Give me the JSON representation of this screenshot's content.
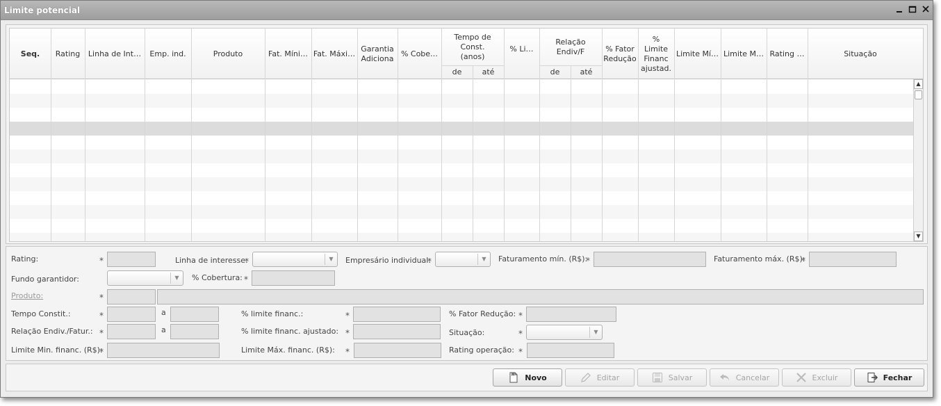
{
  "window": {
    "title": "Limite potencial"
  },
  "grid": {
    "headers": {
      "seq": "Seq.",
      "rating": "Rating",
      "linha": "Linha de Int…",
      "emp": "Emp. ind.",
      "produto": "Produto",
      "fat_min": "Fat. Míni…",
      "fat_max": "Fat. Máxi…",
      "garantia_1": "Garantia",
      "garantia_2": "Adiciona",
      "cobertura": "% Cobe…",
      "tempo_1": "Tempo de",
      "tempo_2": "Const.",
      "tempo_3": "(anos)",
      "tempo_de": "de",
      "tempo_ate": "até",
      "limite": "% Li…",
      "relacao_1": "Relação",
      "relacao_2": "Endiv/F",
      "relacao_de": "de",
      "relacao_ate": "até",
      "fator_1": "% Fator",
      "fator_2": "Redução",
      "lim_aj_1": "%",
      "lim_aj_2": "Limite",
      "lim_aj_3": "Financ",
      "lim_aj_4": "ajustad.",
      "limite_min": "Limite Mí…",
      "limite_max": "Limite M…",
      "rating_op": "Rating …",
      "situacao": "Situação"
    },
    "rows": 12,
    "selected_row": 3
  },
  "form": {
    "rating": "Rating:",
    "linha_interesse": "Linha de interesse:",
    "empresario": "Empresário individual:",
    "fat_min": "Faturamento mín. (R$):",
    "fat_max": "Faturamento máx. (R$):",
    "fundo": "Fundo garantidor:",
    "cobertura": "% Cobertura:",
    "produto": "Produto:",
    "tempo": "Tempo Constit.:",
    "a1": "a",
    "pct_limite": "% limite financ.:",
    "fator": "% Fator Redução:",
    "relacao": "Relação Endiv./Fatur.:",
    "a2": "a",
    "pct_limite_aj": "% limite financ. ajustado:",
    "situacao": "Situação:",
    "lim_min": "Limite Min. financ. (R$):",
    "lim_max": "Limite Máx. financ. (R$):",
    "rating_op": "Rating operação:",
    "required": "*"
  },
  "buttons": {
    "novo": "Novo",
    "editar": "Editar",
    "salvar": "Salvar",
    "cancelar": "Cancelar",
    "excluir": "Excluir",
    "fechar": "Fechar"
  }
}
